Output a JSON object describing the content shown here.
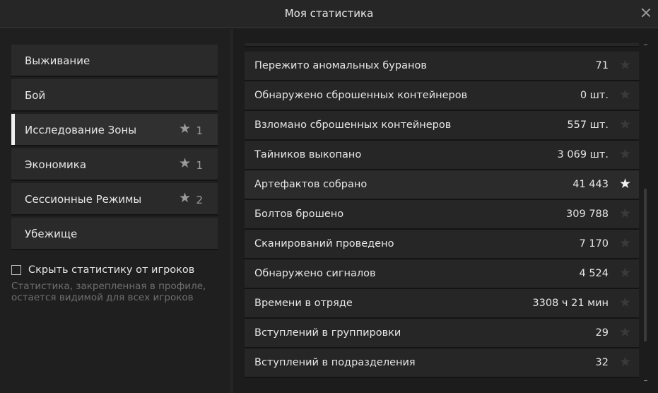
{
  "window": {
    "title": "Моя статистика",
    "close_icon": "close-icon"
  },
  "sidebar": {
    "items": [
      {
        "label": "Выживание",
        "count": "",
        "active": false
      },
      {
        "label": "Бой",
        "count": "",
        "active": false
      },
      {
        "label": "Исследование Зоны",
        "count": "1",
        "active": true
      },
      {
        "label": "Экономика",
        "count": "1",
        "active": false
      },
      {
        "label": "Сессионные Режимы",
        "count": "2",
        "active": false
      },
      {
        "label": "Убежище",
        "count": "",
        "active": false
      }
    ],
    "hide_stats": {
      "label": "Скрыть статистику от игроков",
      "checked": false
    },
    "hint": "Статистика, закрепленная в профиле, остается видимой для всех игроков"
  },
  "stats": [
    {
      "label": "Пережито аномальных буранов",
      "value": "71",
      "pinned": false
    },
    {
      "label": "Обнаружено сброшенных контейнеров",
      "value": "0 шт.",
      "pinned": false
    },
    {
      "label": "Взломано сброшенных контейнеров",
      "value": "557 шт.",
      "pinned": false
    },
    {
      "label": "Тайников выкопано",
      "value": "3 069 шт.",
      "pinned": false
    },
    {
      "label": "Артефактов собрано",
      "value": "41 443",
      "pinned": true
    },
    {
      "label": "Болтов брошено",
      "value": "309 788",
      "pinned": false
    },
    {
      "label": "Сканирований проведено",
      "value": "7 170",
      "pinned": false
    },
    {
      "label": "Обнаружено сигналов",
      "value": "4 524",
      "pinned": false
    },
    {
      "label": "Времени в отряде",
      "value": "3308 ч 21 мин",
      "pinned": false
    },
    {
      "label": "Вступлений в группировки",
      "value": "29",
      "pinned": false
    },
    {
      "label": "Вступлений в подразделения",
      "value": "32",
      "pinned": false
    }
  ],
  "colors": {
    "pinned_star": "#f2f2f2",
    "unpinned_star": "#3a3a3a",
    "active_marker": "#f0f0f0"
  },
  "star_icon": "★"
}
